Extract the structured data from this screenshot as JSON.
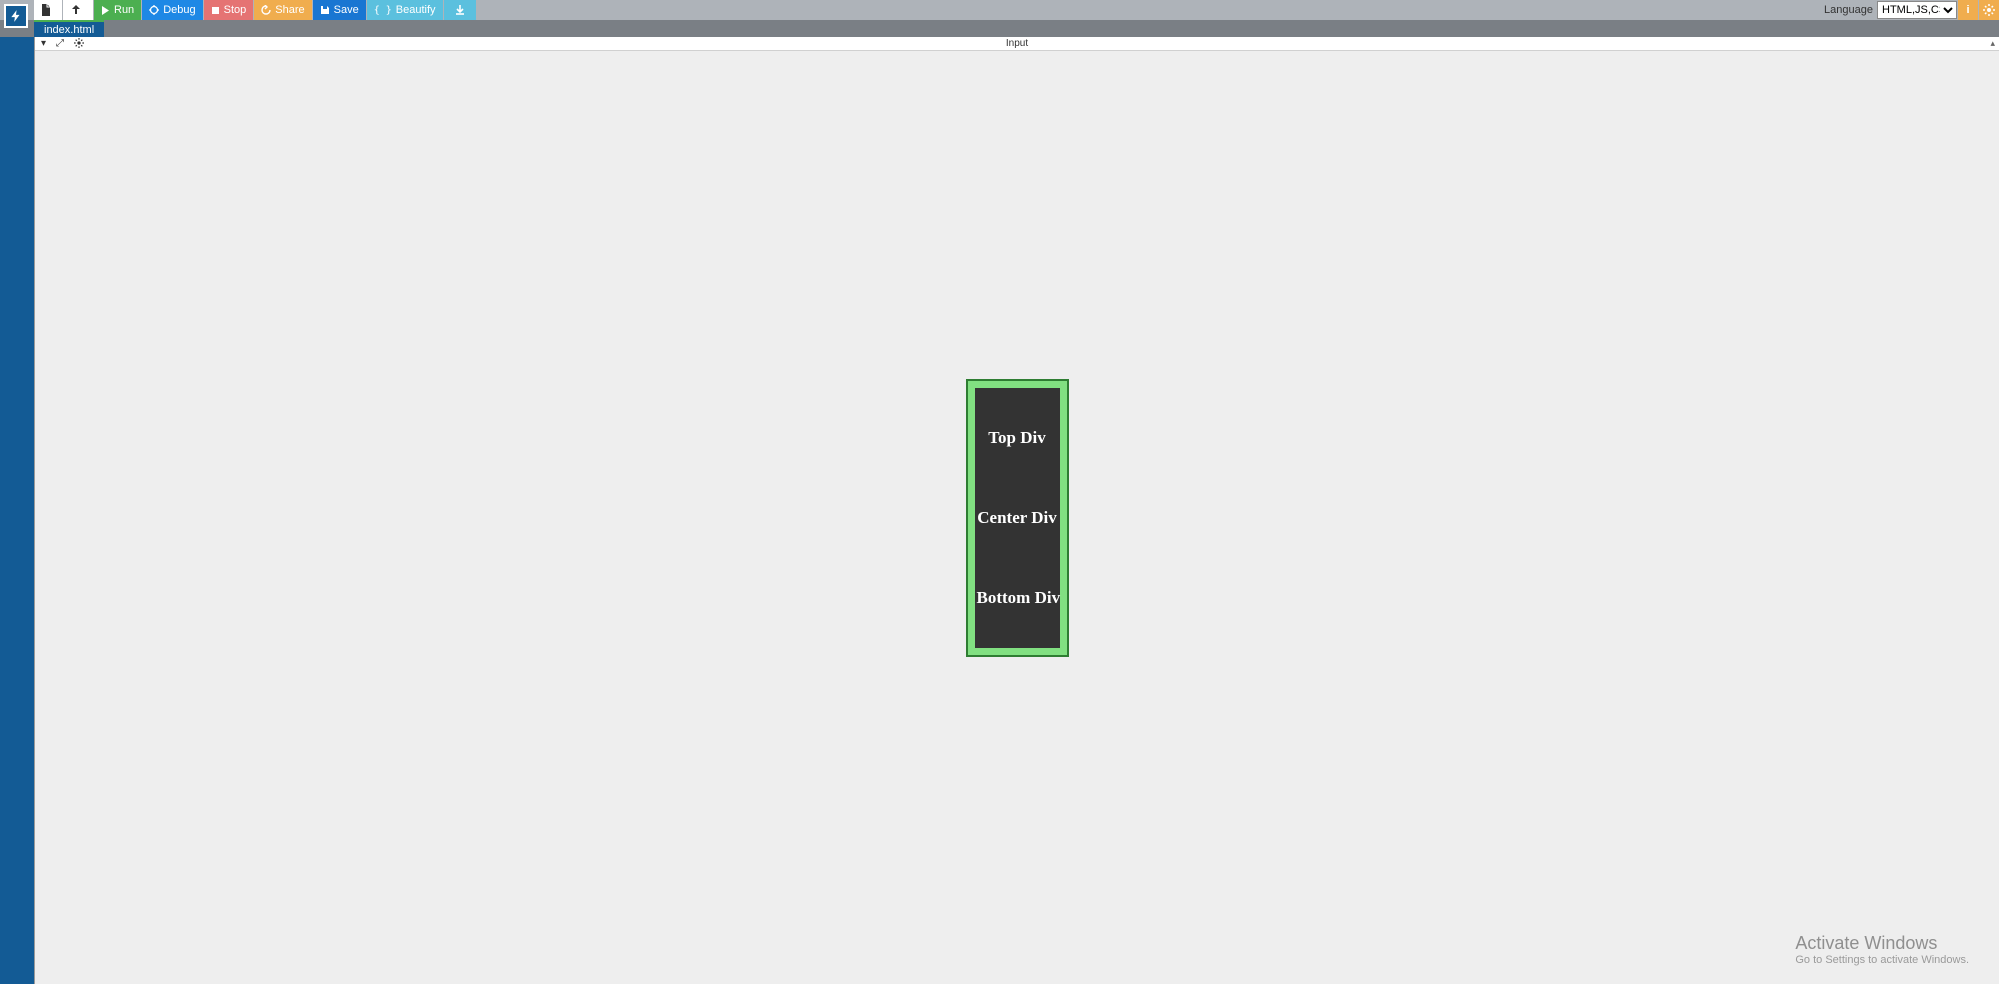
{
  "toolbar": {
    "run": "Run",
    "debug": "Debug",
    "stop": "Stop",
    "share": "Share",
    "save": "Save",
    "beautify": "Beautify",
    "language_label": "Language",
    "language_value": "HTML,JS,CSS"
  },
  "tabs": {
    "file": "index.html"
  },
  "preview": {
    "title": "Input"
  },
  "output": {
    "top": "Top Div",
    "center": "Center Div",
    "bottom": "Bottom Div"
  },
  "watermark": {
    "line1": "Activate Windows",
    "line2": "Go to Settings to activate Windows."
  }
}
